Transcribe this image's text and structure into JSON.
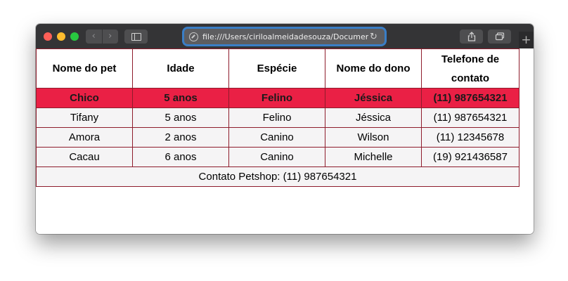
{
  "browser": {
    "url": "file:///Users/ciriloalmeidadesouza/Documents/",
    "new_tab_label": "+"
  },
  "table": {
    "headers": [
      "Nome do pet",
      "Idade",
      "Espécie",
      "Nome do dono",
      "Telefone de contato"
    ],
    "highlight_row": [
      "Chico",
      "5 anos",
      "Felino",
      "Jéssica",
      "(11) 987654321"
    ],
    "rows": [
      [
        "Tifany",
        "5 anos",
        "Felino",
        "Jéssica",
        "(11) 987654321"
      ],
      [
        "Amora",
        "2 anos",
        "Canino",
        "Wilson",
        "(11) 12345678"
      ],
      [
        "Cacau",
        "6 anos",
        "Canino",
        "Michelle",
        "(19) 921436587"
      ]
    ],
    "footer": "Contato Petshop: (11) 987654321"
  },
  "colors": {
    "highlight_row": "#ea2045",
    "border": "#8e1c2c",
    "row_bg": "#f5f4f5",
    "toolbar": "#343436"
  }
}
